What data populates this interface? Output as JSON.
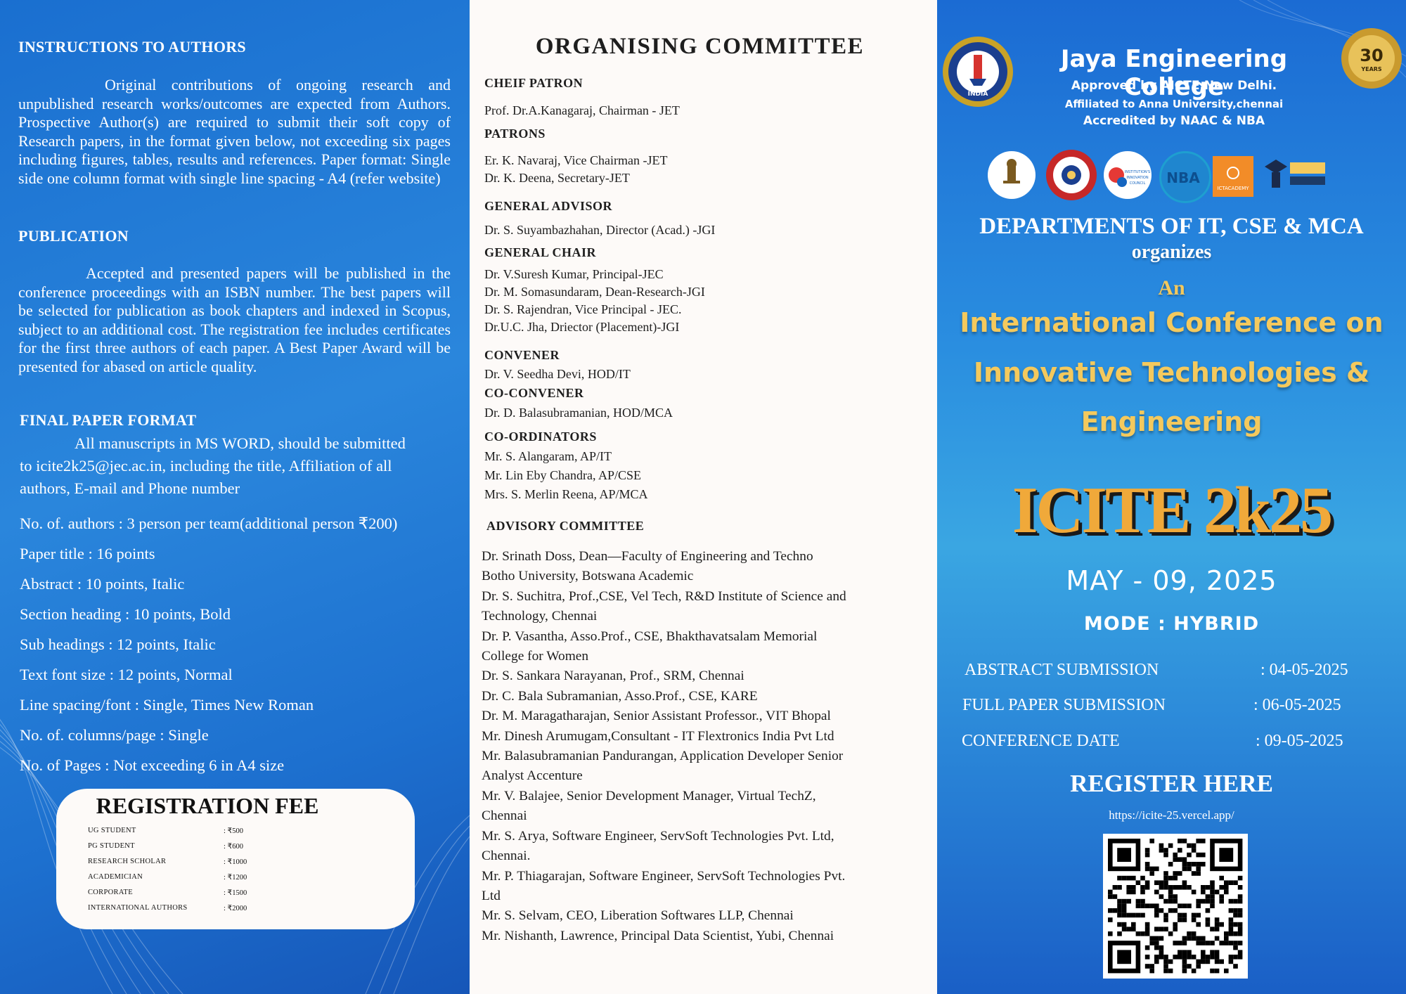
{
  "left": {
    "instructions_heading": "INSTRUCTIONS TO AUTHORS",
    "instructions_text": "Original contributions of ongoing research and unpublished research works/outcomes are expected from Authors. Prospective Author(s) are required to submit their soft copy of Research papers, in the format given below, not exceeding six pages including figures, tables, results and references. Paper format: Single side one column format with single line spacing - A4 (refer website)",
    "publication_heading": "PUBLICATION",
    "publication_text": "Accepted and presented papers will be published in the conference proceedings with an ISBN number. The best papers will be selected for publication as book chapters and indexed in Scopus, subject to an additional cost. The registration fee includes certificates for the first three authors of each paper. A Best Paper Award will be presented for abased on article quality.",
    "final_heading": "FINAL PAPER FORMAT",
    "final_text_line1": "All manuscripts in MS WORD, should be submitted",
    "final_text_line2": "to icite2k25@jec.ac.in, including the title, Affiliation of all",
    "final_text_line3": "authors, E-mail and Phone number",
    "format_items": [
      "No. of. authors : 3 person per team(additional person ₹200)",
      "Paper title : 16 points",
      "Abstract : 10 points, Italic",
      "Section heading : 10 points, Bold",
      "Sub headings : 12 points, Italic",
      "Text font size : 12 points, Normal",
      "Line spacing/font : Single, Times New Roman",
      "No. of. columns/page : Single",
      "No. of Pages : Not exceeding 6 in A4 size"
    ],
    "fee": {
      "title": "REGISTRATION FEE",
      "rows": [
        {
          "category": "UG STUDENT",
          "amount": ": ₹500"
        },
        {
          "category": "PG STUDENT",
          "amount": ": ₹600"
        },
        {
          "category": "RESEARCH  SCHOLAR",
          "amount": ": ₹1000"
        },
        {
          "category": "ACADEMICIAN",
          "amount": ": ₹1200"
        },
        {
          "category": "CORPORATE",
          "amount": ": ₹1500"
        },
        {
          "category": "INTERNATIONAL   AUTHORS",
          "amount": ": ₹2000"
        }
      ]
    }
  },
  "middle": {
    "title": "ORGANISING COMMITTEE",
    "chief_patron_heading": "CHEIF PATRON",
    "chief_patron": "Prof. Dr.A.Kanagaraj, Chairman - JET",
    "patrons_heading": "PATRONS",
    "patrons": [
      "Er. K. Navaraj, Vice Chairman -JET",
      "Dr. K. Deena, Secretary-JET"
    ],
    "general_advisor_heading": "GENERAL ADVISOR",
    "general_advisor": "Dr. S. Suyambazhahan, Director (Acad.) -JGI",
    "general_chair_heading": "GENERAL CHAIR",
    "general_chair": [
      "Dr. V.Suresh Kumar, Principal-JEC",
      "Dr. M. Somasundaram, Dean-Research-JGI",
      "Dr. S. Rajendran, Vice Principal - JEC.",
      "Dr.U.C. Jha, Driector (Placement)-JGI"
    ],
    "convener_heading": "CONVENER",
    "convener": "Dr. V. Seedha Devi, HOD/IT",
    "co_convener_heading": "CO-CONVENER",
    "co_convener": "Dr. D. Balasubramanian, HOD/MCA",
    "coordinators_heading": "CO-ORDINATORS",
    "coordinators": [
      "Mr. S. Alangaram, AP/IT",
      "Mr. Lin Eby Chandra, AP/CSE",
      "Mrs. S. Merlin Reena, AP/MCA"
    ],
    "advisory_heading": "ADVISORY COMMITTEE",
    "advisory_lines": [
      "Dr. Srinath Doss, Dean—Faculty of Engineering and Techno",
      "Botho University, Botswana Academic",
      "Dr. S. Suchitra, Prof.,CSE, Vel Tech, R&D Institute of Science and",
      "Technology, Chennai",
      "Dr. P. Vasantha, Asso.Prof., CSE, Bhakthavatsalam Memorial",
      "College for Women",
      "Dr. S. Sankara Narayanan, Prof., SRM, Chennai",
      "Dr. C. Bala Subramanian, Asso.Prof., CSE, KARE",
      "Dr. M. Maragatharajan, Senior Assistant Professor., VIT Bhopal",
      "Mr. Dinesh Arumugam,Consultant - IT Flextronics India Pvt Ltd",
      "Mr. Balasubramanian Pandurangan, Application Developer Senior",
      "Analyst Accenture",
      "Mr. V. Balajee, Senior Development Manager, Virtual TechZ,",
      "Chennai",
      "Mr. S. Arya, Software Engineer, ServSoft Technologies Pvt. Ltd,",
      "Chennai.",
      "Mr. P. Thiagarajan, Software Engineer, ServSoft Technologies Pvt.",
      "Ltd",
      "Mr. S. Selvam, CEO, Liberation Softwares LLP, Chennai",
      "Mr. Nishanth, Lawrence, Principal Data Scientist, Yubi, Chennai"
    ]
  },
  "right": {
    "college_name": "Jaya Engineering College",
    "approved": "Approved by AICTE,New Delhi.",
    "affiliated": "Affiliated to Anna University,chennai",
    "accredited": "Accredited by NAAC & NBA",
    "badge_number": "30",
    "badge_word": "YEARS",
    "seal_text": "INDIA",
    "partner_logos": [
      "emblem-logo",
      "iic-logo",
      "innovation-council-logo",
      "nba-logo",
      "ictacademy-logo",
      "naan-mudhalvan-logo"
    ],
    "ictacademy_label": "ICTACADEMY",
    "iic_label": "INSTITUTION'S INNOVATION COUNCIL",
    "nba_label": "NBA",
    "departments": "DEPARTMENTS OF IT, CSE & MCA",
    "organizes": "organizes",
    "an": "An",
    "conf_title_lines": [
      "International Conference on",
      "Innovative Technologies &",
      "Engineering"
    ],
    "acronym": "ICITE 2k25",
    "date": "MAY - 09, 2025",
    "mode": "MODE : HYBRID",
    "important_dates": [
      {
        "label": "ABSTRACT SUBMISSION",
        "value": ":  04-05-2025"
      },
      {
        "label": "FULL PAPER SUBMISSION",
        "value": ":   06-05-2025"
      },
      {
        "label": "CONFERENCE DATE",
        "value": ":   09-05-2025"
      }
    ],
    "register_heading": "REGISTER HERE",
    "register_url": "https://icite-25.vercel.app/"
  },
  "colors": {
    "gold": "#f4c95d",
    "acronym": "#f0a93a",
    "panel_blue": "#1f78d6"
  }
}
